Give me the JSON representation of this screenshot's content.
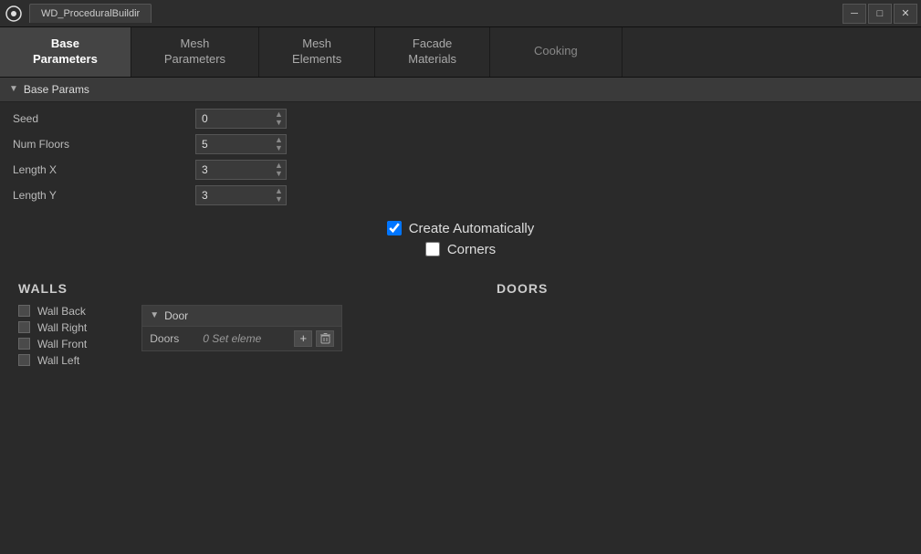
{
  "titlebar": {
    "logo": "U",
    "tab_label": "WD_ProceduralBuildir",
    "min_btn": "─",
    "max_btn": "□",
    "close_btn": "✕"
  },
  "tabs": [
    {
      "id": "base-parameters",
      "label": "Base\nParameters",
      "active": true
    },
    {
      "id": "mesh-parameters",
      "label": "Mesh\nParameters",
      "active": false
    },
    {
      "id": "mesh-elements",
      "label": "Mesh\nElements",
      "active": false
    },
    {
      "id": "facade-materials",
      "label": "Facade\nMaterials",
      "active": false
    },
    {
      "id": "cooking",
      "label": "Cooking",
      "active": false
    }
  ],
  "base_params": {
    "section_label": "Base Params",
    "fields": [
      {
        "id": "seed",
        "label": "Seed",
        "value": "0"
      },
      {
        "id": "num-floors",
        "label": "Num Floors",
        "value": "5"
      },
      {
        "id": "length-x",
        "label": "Length X",
        "value": "3"
      },
      {
        "id": "length-y",
        "label": "Length Y",
        "value": "3"
      }
    ],
    "create_automatically": {
      "label": "Create Automatically",
      "checked": true
    },
    "corners": {
      "label": "Corners",
      "checked": false
    }
  },
  "walls": {
    "title": "WALLS",
    "items": [
      {
        "id": "wall-back",
        "label": "Wall Back",
        "checked": false
      },
      {
        "id": "wall-right",
        "label": "Wall Right",
        "checked": false
      },
      {
        "id": "wall-front",
        "label": "Wall Front",
        "checked": false
      },
      {
        "id": "wall-left",
        "label": "Wall Left",
        "checked": false
      }
    ]
  },
  "doors": {
    "title": "DOORS",
    "section_label": "Door",
    "row_label": "Doors",
    "row_value": "0 Set eleme",
    "add_btn": "+",
    "delete_btn": "🗑"
  }
}
